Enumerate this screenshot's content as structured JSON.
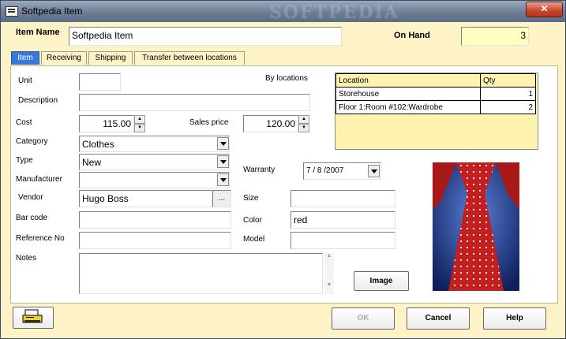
{
  "window": {
    "title": "Softpedia Item",
    "watermark": "SOFTPEDIA",
    "close_label": "✕"
  },
  "header": {
    "item_name_label": "Item Name",
    "item_name_value": "Softpedia Item",
    "on_hand_label": "On Hand",
    "on_hand_value": "3"
  },
  "tabs": [
    "Item",
    "Receiving",
    "Shipping",
    "Transfer between  locations"
  ],
  "form": {
    "unit_label": "Unit",
    "unit_value": "",
    "description_label": "Description",
    "description_value": "",
    "by_locations_label": "By locations",
    "cost_label": "Cost",
    "cost_value": "115.00",
    "sales_price_label": "Sales price",
    "sales_price_value": "120.00",
    "category_label": "Category",
    "category_value": "Clothes",
    "type_label": "Type",
    "type_value": "New",
    "manufacturer_label": "Manufacturer",
    "manufacturer_value": "",
    "warranty_label": "Warranty",
    "warranty_value": "7 / 8 /2007",
    "vendor_label": "Vendor",
    "vendor_value": "Hugo Boss",
    "vendor_browse": "...",
    "size_label": "Size",
    "size_value": "",
    "barcode_label": "Bar code",
    "barcode_value": "",
    "color_label": "Color",
    "color_value": "red",
    "refno_label": "Reference No",
    "refno_value": "",
    "model_label": "Model",
    "model_value": "",
    "notes_label": "Notes",
    "notes_value": "",
    "image_button": "Image"
  },
  "locations": {
    "headers": [
      "Location",
      "Qty"
    ],
    "rows": [
      {
        "location": "Storehouse",
        "qty": "1"
      },
      {
        "location": "Floor 1:Room #102:Wardrobe",
        "qty": "2"
      }
    ]
  },
  "footer": {
    "ok_label": "OK",
    "cancel_label": "Cancel",
    "help_label": "Help"
  }
}
